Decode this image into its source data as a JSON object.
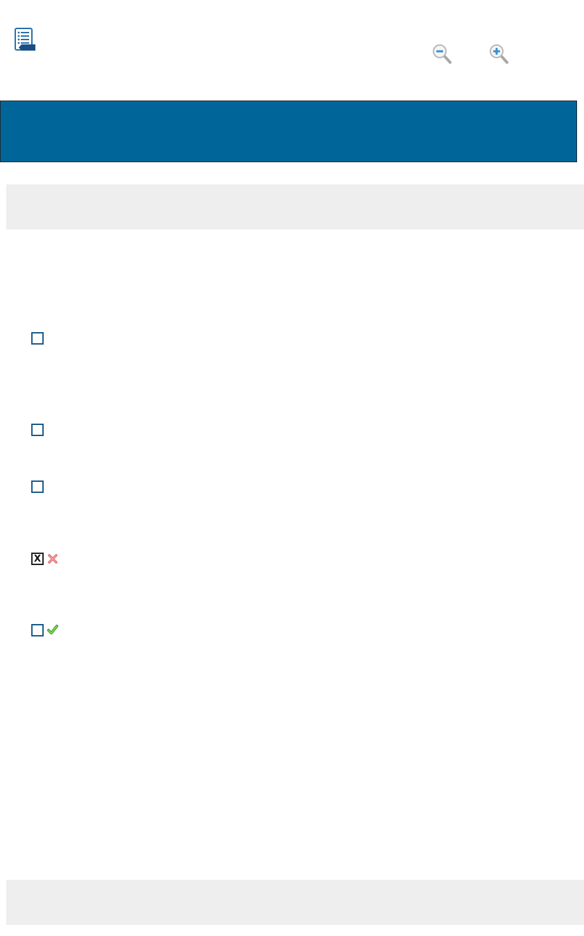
{
  "toolbar": {
    "outline_icon": "document-list-icon",
    "zoom_out_icon": "zoom-out-icon",
    "zoom_in_icon": "zoom-in-icon"
  },
  "colors": {
    "header_bar": "#006699",
    "gray_band": "#eeeeee",
    "incorrect_mark": "#e06a6a",
    "correct_mark": "#4cb82a",
    "checkbox_border": "#1a5a8a"
  },
  "options": [
    {
      "checked": false,
      "mark": ""
    },
    {
      "checked": false,
      "mark": ""
    },
    {
      "checked": false,
      "mark": ""
    },
    {
      "checked": true,
      "checkbox_glyph": "X",
      "mark": "incorrect-x-icon"
    },
    {
      "checked": false,
      "mark": "correct-check-icon"
    }
  ]
}
